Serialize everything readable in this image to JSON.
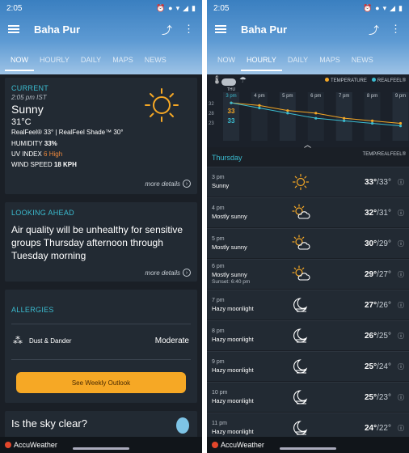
{
  "left": {
    "status": {
      "time": "2:05",
      "icons": [
        "alarm",
        "location",
        "volte",
        "vibrate",
        "wifi",
        "signal",
        "battery"
      ]
    },
    "city": "Baha Pur",
    "tabs": [
      "NOW",
      "HOURLY",
      "DAILY",
      "MAPS",
      "NEWS"
    ],
    "active_tab": "NOW",
    "current": {
      "heading": "CURRENT",
      "time": "2:05 pm IST",
      "condition": "Sunny",
      "temp": "31°C",
      "realfeel": "RealFeel® 33° | RealFeel Shade™ 30°",
      "humidity_label": "HUMIDITY",
      "humidity": "33%",
      "uv_label": "UV INDEX",
      "uv": "6 High",
      "wind_label": "WIND SPEED",
      "wind": "18 KPH",
      "more": "more details"
    },
    "ahead": {
      "heading": "LOOKING AHEAD",
      "text": "Air quality will be unhealthy for sensitive groups Thursday afternoon through Tuesday morning",
      "more": "more details"
    },
    "allergies": {
      "heading": "ALLERGIES",
      "item": "Dust & Dander",
      "level": "Moderate",
      "button": "See Weekly Outlook"
    },
    "sky": {
      "text": "Is the sky clear?"
    },
    "footer": "AccuWeather"
  },
  "right": {
    "status": {
      "time": "2:05"
    },
    "city": "Baha Pur",
    "tabs": [
      "NOW",
      "HOURLY",
      "DAILY",
      "MAPS",
      "NEWS"
    ],
    "active_tab": "HOURLY",
    "legend": {
      "temperature": "TEMPERATURE",
      "realfeel": "REALFEEL®"
    },
    "chart_data": {
      "type": "line",
      "x": [
        "3 pm",
        "4 pm",
        "5 pm",
        "6 pm",
        "7 pm",
        "8 pm",
        "9 pm"
      ],
      "series": [
        {
          "name": "TEMPERATURE",
          "values": [
            33,
            32,
            30,
            29,
            27,
            26,
            25
          ]
        },
        {
          "name": "REALFEEL®",
          "values": [
            33,
            31,
            29,
            27,
            26,
            25,
            24
          ]
        }
      ],
      "ylabels": [
        "32",
        "28",
        "23"
      ],
      "first_label_top": "33",
      "first_label_bottom": "33",
      "day_label": "THU",
      "colors": {
        "temperature": "#f6a825",
        "realfeel": "#3bbcd0"
      }
    },
    "day_label": "Thursday",
    "col_header": "TEMP/REALFEEL®",
    "hours": [
      {
        "time": "3 pm",
        "cond": "Sunny",
        "icon": "sun-icon",
        "temp": "33°",
        "rf": "/33°",
        "extra": ""
      },
      {
        "time": "4 pm",
        "cond": "Mostly sunny",
        "icon": "partly-sunny-icon",
        "temp": "32°",
        "rf": "/31°",
        "extra": ""
      },
      {
        "time": "5 pm",
        "cond": "Mostly sunny",
        "icon": "partly-sunny-icon",
        "temp": "30°",
        "rf": "/29°",
        "extra": ""
      },
      {
        "time": "6 pm",
        "cond": "Mostly sunny",
        "icon": "partly-sunny-icon",
        "temp": "29°",
        "rf": "/27°",
        "extra": "Sunset: 6:40 pm"
      },
      {
        "time": "7 pm",
        "cond": "Hazy moonlight",
        "icon": "hazy-moon-icon",
        "temp": "27°",
        "rf": "/26°",
        "extra": ""
      },
      {
        "time": "8 pm",
        "cond": "Hazy moonlight",
        "icon": "hazy-moon-icon",
        "temp": "26°",
        "rf": "/25°",
        "extra": ""
      },
      {
        "time": "9 pm",
        "cond": "Hazy moonlight",
        "icon": "hazy-moon-icon",
        "temp": "25°",
        "rf": "/24°",
        "extra": ""
      },
      {
        "time": "10 pm",
        "cond": "Hazy moonlight",
        "icon": "hazy-moon-icon",
        "temp": "25°",
        "rf": "/23°",
        "extra": ""
      },
      {
        "time": "11 pm",
        "cond": "Hazy moonlight",
        "icon": "hazy-moon-icon",
        "temp": "24°",
        "rf": "/22°",
        "extra": ""
      }
    ],
    "footer": "AccuWeather"
  }
}
